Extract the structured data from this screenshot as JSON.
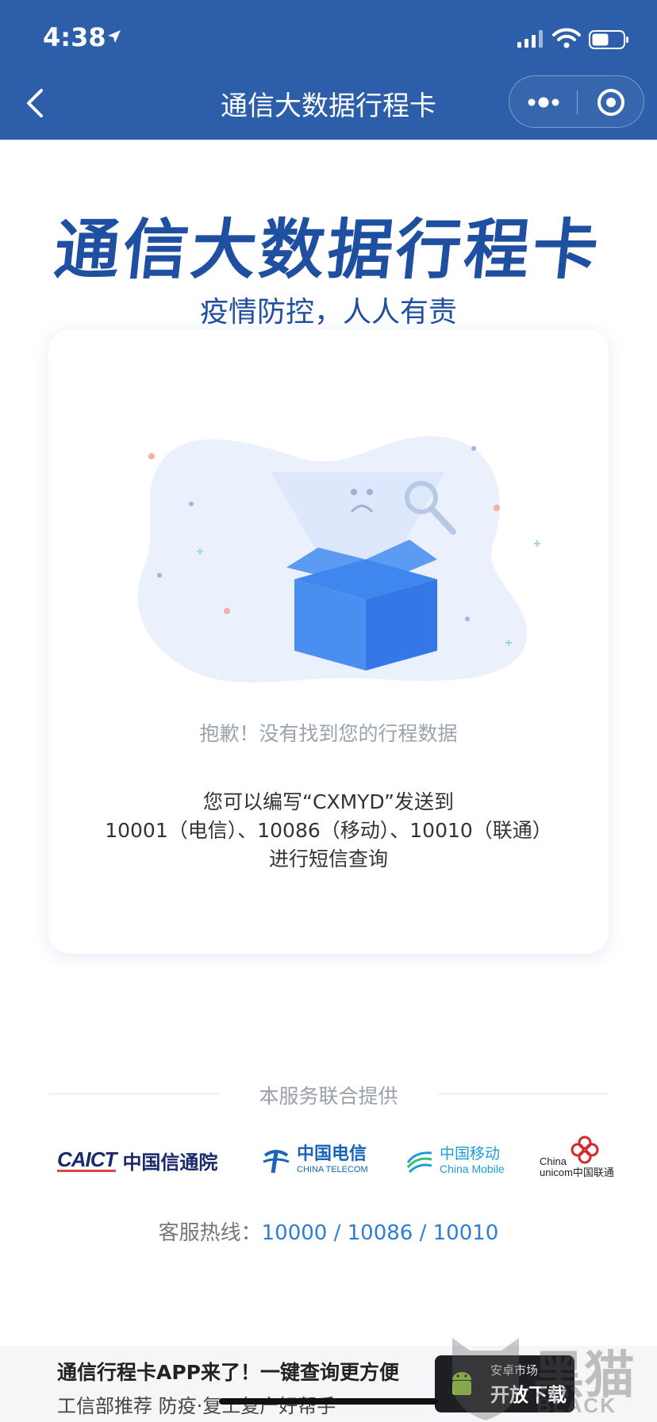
{
  "status_bar": {
    "time": "4:38"
  },
  "nav": {
    "title": "通信大数据行程卡"
  },
  "hero": {
    "title": "通信大数据行程卡",
    "subtitle": "疫情防控，人人有责"
  },
  "card": {
    "empty_text": "抱歉！没有找到您的行程数据",
    "hint_line1": "您可以编写“CXMYD”发送到",
    "hint_line2": "10001（电信）、10086（移动）、10010（联通）",
    "hint_line3": "进行短信查询"
  },
  "providers": {
    "label": "本服务联合提供",
    "caict_en": "CAICT",
    "caict_cn": "中国信通院",
    "telecom_cn": "中国电信",
    "telecom_en": "CHINA TELECOM",
    "mobile_cn": "中国移动",
    "mobile_en": "China Mobile",
    "unicom_line1": "China",
    "unicom_line2": "unicom中国联通"
  },
  "hotline": {
    "label": "客服热线：",
    "numbers": "10000 / 10086 / 10010"
  },
  "banner": {
    "title": "通信行程卡APP来了！一键查询更方便",
    "subtitle": "工信部推荐 防疫·复工复产好帮手",
    "button_small": "安卓市场",
    "button_main": "开放下载"
  },
  "watermark": {
    "text": "黑猫",
    "sub": "BLACK CAT"
  },
  "colors": {
    "header_bg": "#2c5ea9",
    "title_blue": "#1f4fa0",
    "link_blue": "#2d7ed6"
  }
}
